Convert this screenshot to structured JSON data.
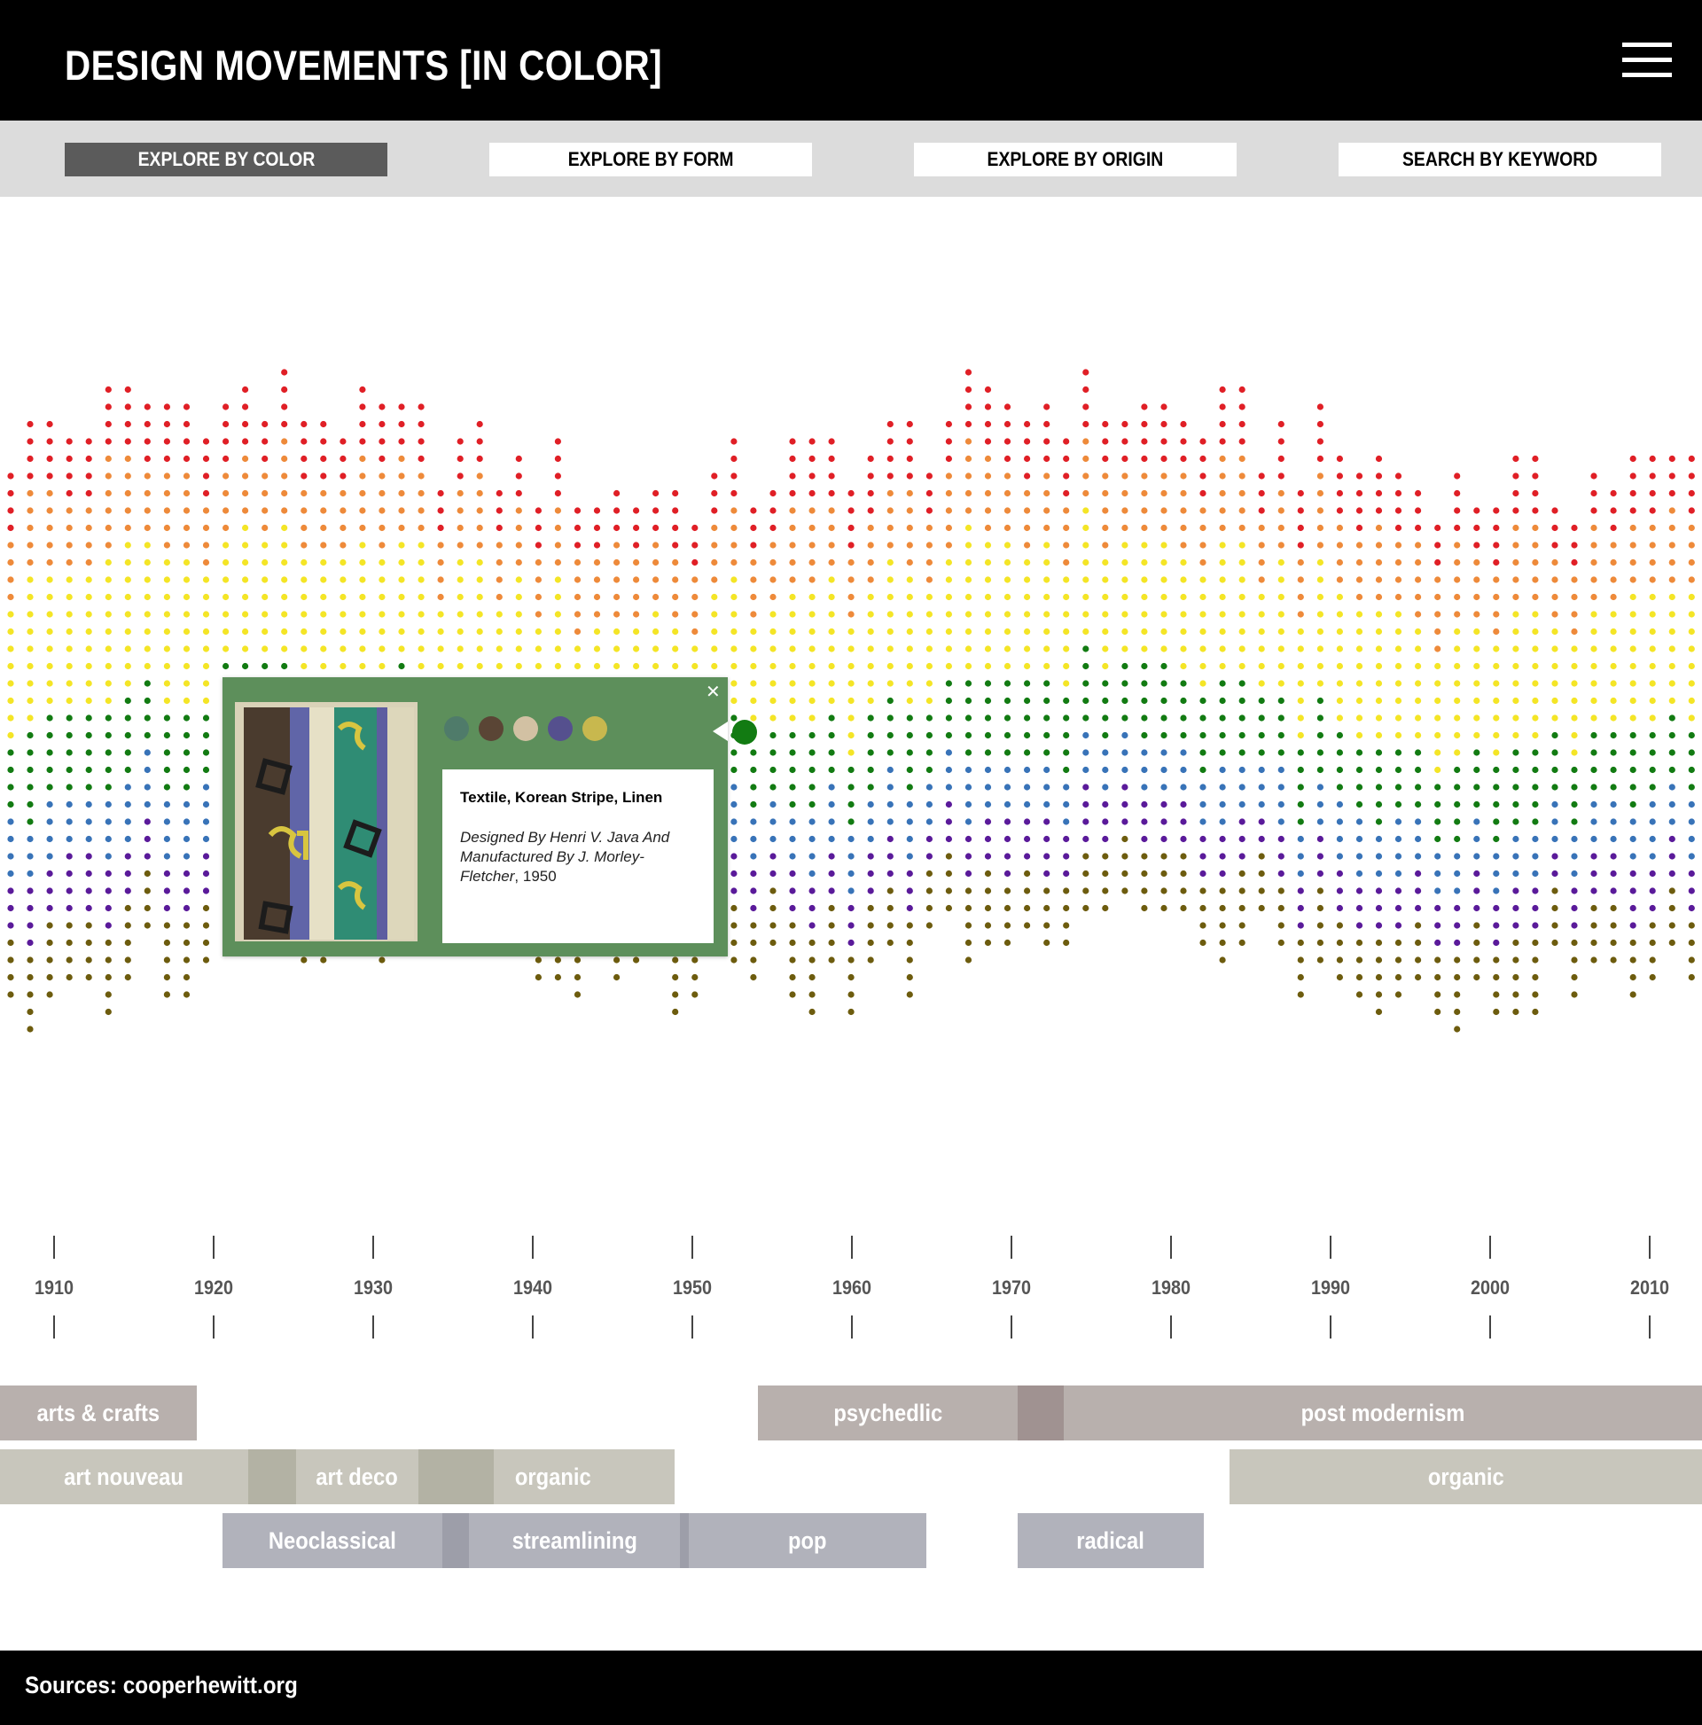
{
  "header": {
    "title": "DESIGN MOVEMENTS [IN COLOR]",
    "menu_icon": "hamburger-icon"
  },
  "nav": {
    "explore_color": "EXPLORE BY COLOR",
    "explore_form": "EXPLORE BY FORM",
    "explore_origin": "EXPLORE BY ORIGIN",
    "search_keyword": "SEARCH BY KEYWORD",
    "active": "EXPLORE BY COLOR"
  },
  "colors": {
    "red": "#e01f26",
    "orange": "#ee8a3a",
    "yellow": "#f4e526",
    "green": "#127b12",
    "blue": "#3873b8",
    "purple": "#5a1a9a",
    "olive": "#6d5c0e",
    "popup_bg": "#5d8f5b"
  },
  "years": [
    "1910",
    "1920",
    "1930",
    "1940",
    "1950",
    "1960",
    "1970",
    "1980",
    "1990",
    "2000",
    "2010"
  ],
  "popup": {
    "title": "Textile, Korean Stripe, Linen",
    "designer": "Designed By Henri V. Java And Manufactured By J. Morley-Fletcher",
    "year": "1950",
    "close_icon": "close-icon",
    "swatches": [
      "#4f7b6a",
      "#5a4535",
      "#d2c1a3",
      "#55508e",
      "#c8b84e"
    ]
  },
  "movements": {
    "arts_crafts": "arts & crafts",
    "psychedlic": "psychedlic",
    "post_modernism": "post modernism",
    "art_nouveau": "art nouveau",
    "art_deco": "art deco",
    "organic_1": "organic",
    "organic_2": "organic",
    "neoclassical": "Neoclassical",
    "streamlining": "streamlining",
    "pop": "pop",
    "radical": "radical"
  },
  "footer": {
    "sources": "Sources: cooperhewitt.org"
  }
}
